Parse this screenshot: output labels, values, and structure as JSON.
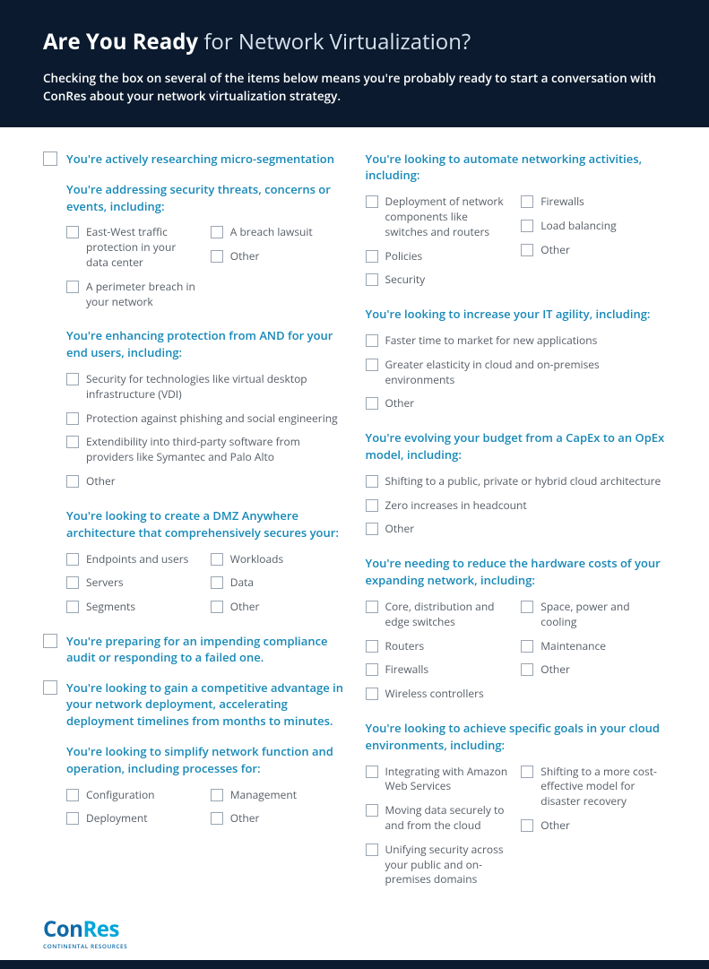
{
  "header": {
    "title_bold": "Are You Ready",
    "title_rest": " for Network Virtualization?",
    "subtitle": "Checking the box on several of the items below means you're probably ready to start a conversation with ConRes about your network virtualization strategy."
  },
  "left": {
    "top1": "You're actively researching micro-segmentation",
    "g1_title": "You're addressing security threats, concerns or events, including:",
    "g1_colA": [
      "East-West traffic protection in your data center",
      "A perimeter breach in your network"
    ],
    "g1_colB": [
      "A breach lawsuit",
      "Other"
    ],
    "g2_title": "You're enhancing protection from AND for your end users, including:",
    "g2_items": [
      "Security for technologies like virtual desktop infrastructure (VDI)",
      "Protection against phishing and social engineering",
      "Extendibility into third-party software from providers like Symantec and Palo Alto",
      "Other"
    ],
    "g3_title": "You're looking to create a DMZ Anywhere architecture that comprehensively secures your:",
    "g3_colA": [
      "Endpoints and users",
      "Servers",
      "Segments"
    ],
    "g3_colB": [
      "Workloads",
      "Data",
      "Other"
    ],
    "top2": "You're preparing for an impending compliance audit or responding to a failed one.",
    "top3": "You're looking to gain a competitive advantage in your network deployment, accelerating deployment timelines from months to minutes.",
    "g4_title": "You're looking to simplify network function and operation, including processes for:",
    "g4_colA": [
      "Configuration",
      "Deployment"
    ],
    "g4_colB": [
      "Management",
      "Other"
    ]
  },
  "right": {
    "g1_title": "You're looking to automate networking activities, including:",
    "g1_colA": [
      "Deployment of network components like switches and routers",
      "Policies",
      "Security"
    ],
    "g1_colB": [
      "Firewalls",
      "Load balancing",
      "Other"
    ],
    "g2_title": "You're looking to increase your IT agility, including:",
    "g2_items": [
      "Faster time to market for new applications",
      "Greater elasticity in cloud and on-premises environments",
      "Other"
    ],
    "g3_title": "You're evolving your budget from a CapEx to an OpEx model, including:",
    "g3_items": [
      "Shifting to a public, private or hybrid cloud architecture",
      "Zero increases in headcount",
      "Other"
    ],
    "g4_title": "You're needing to reduce the hardware costs of your expanding network, including:",
    "g4_colA": [
      "Core, distribution and edge switches",
      "Routers",
      "Firewalls",
      "Wireless controllers"
    ],
    "g4_colB": [
      "Space, power and cooling",
      "Maintenance",
      "Other"
    ],
    "g5_title": "You're looking to achieve specific goals in your cloud environments, including:",
    "g5_colA": [
      "Integrating with Amazon Web Services",
      "Moving data securely to and from the cloud",
      "Unifying security across your public and on-premises domains"
    ],
    "g5_colB": [
      "Shifting to a more cost-effective model for disaster recovery",
      "Other"
    ]
  },
  "logo": {
    "part1": "Con",
    "part2": "Res",
    "sub": "CONTINENTAL RESOURCES"
  }
}
